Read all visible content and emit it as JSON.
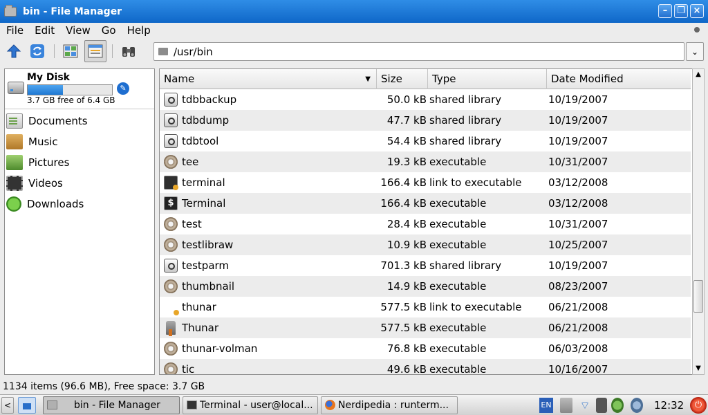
{
  "window": {
    "title": "bin - File Manager",
    "controls": {
      "minimize": "–",
      "restore": "❐",
      "close": "×"
    }
  },
  "menu": [
    {
      "label": "File"
    },
    {
      "label": "Edit"
    },
    {
      "label": "View"
    },
    {
      "label": "Go"
    },
    {
      "label": "Help"
    }
  ],
  "toolbar": {
    "path": "/usr/bin",
    "dropdown": "⌄",
    "icons": [
      "up-arrow-icon",
      "reload-icon",
      "icon-view-icon",
      "detail-view-icon",
      "binoculars-icon"
    ]
  },
  "sidebar": {
    "disk": {
      "name": "My Disk",
      "free_text": "3.7 GB free of 6.4 GB",
      "used_fraction": 0.42
    },
    "places": [
      {
        "label": "Documents",
        "icon": "documents-folder-icon"
      },
      {
        "label": "Music",
        "icon": "music-folder-icon"
      },
      {
        "label": "Pictures",
        "icon": "pictures-folder-icon"
      },
      {
        "label": "Videos",
        "icon": "videos-folder-icon"
      },
      {
        "label": "Downloads",
        "icon": "downloads-folder-icon"
      }
    ]
  },
  "filelist": {
    "columns": {
      "name": "Name",
      "size": "Size",
      "type": "Type",
      "date": "Date Modified"
    },
    "rows": [
      {
        "name": "tdbbackup",
        "size": "50.0 kB",
        "type": "shared library",
        "date": "10/19/2007",
        "icon": "lib"
      },
      {
        "name": "tdbdump",
        "size": "47.7 kB",
        "type": "shared library",
        "date": "10/19/2007",
        "icon": "lib"
      },
      {
        "name": "tdbtool",
        "size": "54.4 kB",
        "type": "shared library",
        "date": "10/19/2007",
        "icon": "lib"
      },
      {
        "name": "tee",
        "size": "19.3 kB",
        "type": "executable",
        "date": "10/31/2007",
        "icon": "exec"
      },
      {
        "name": "terminal",
        "size": "166.4 kB",
        "type": "link to executable",
        "date": "03/12/2008",
        "icon": "link"
      },
      {
        "name": "Terminal",
        "size": "166.4 kB",
        "type": "executable",
        "date": "03/12/2008",
        "icon": "term"
      },
      {
        "name": "test",
        "size": "28.4 kB",
        "type": "executable",
        "date": "10/31/2007",
        "icon": "exec"
      },
      {
        "name": "testlibraw",
        "size": "10.9 kB",
        "type": "executable",
        "date": "10/25/2007",
        "icon": "exec"
      },
      {
        "name": "testparm",
        "size": "701.3 kB",
        "type": "shared library",
        "date": "10/19/2007",
        "icon": "lib"
      },
      {
        "name": "thumbnail",
        "size": "14.9 kB",
        "type": "executable",
        "date": "08/23/2007",
        "icon": "exec"
      },
      {
        "name": "thunar",
        "size": "577.5 kB",
        "type": "link to executable",
        "date": "06/21/2008",
        "icon": "execlink"
      },
      {
        "name": "Thunar",
        "size": "577.5 kB",
        "type": "executable",
        "date": "06/21/2008",
        "icon": "thunar"
      },
      {
        "name": "thunar-volman",
        "size": "76.8 kB",
        "type": "executable",
        "date": "06/03/2008",
        "icon": "exec"
      },
      {
        "name": "tic",
        "size": "49.6 kB",
        "type": "executable",
        "date": "10/16/2007",
        "icon": "exec"
      }
    ]
  },
  "status": "1134 items (96.6 MB), Free space: 3.7 GB",
  "taskbar": {
    "tasks": [
      {
        "label": "bin - File Manager",
        "icon": "folder"
      },
      {
        "label": "Terminal - user@local...",
        "icon": "termi"
      },
      {
        "label": "Nerdipedia : runterm...",
        "icon": "fox"
      }
    ],
    "lang": "EN",
    "clock": "12:32"
  }
}
